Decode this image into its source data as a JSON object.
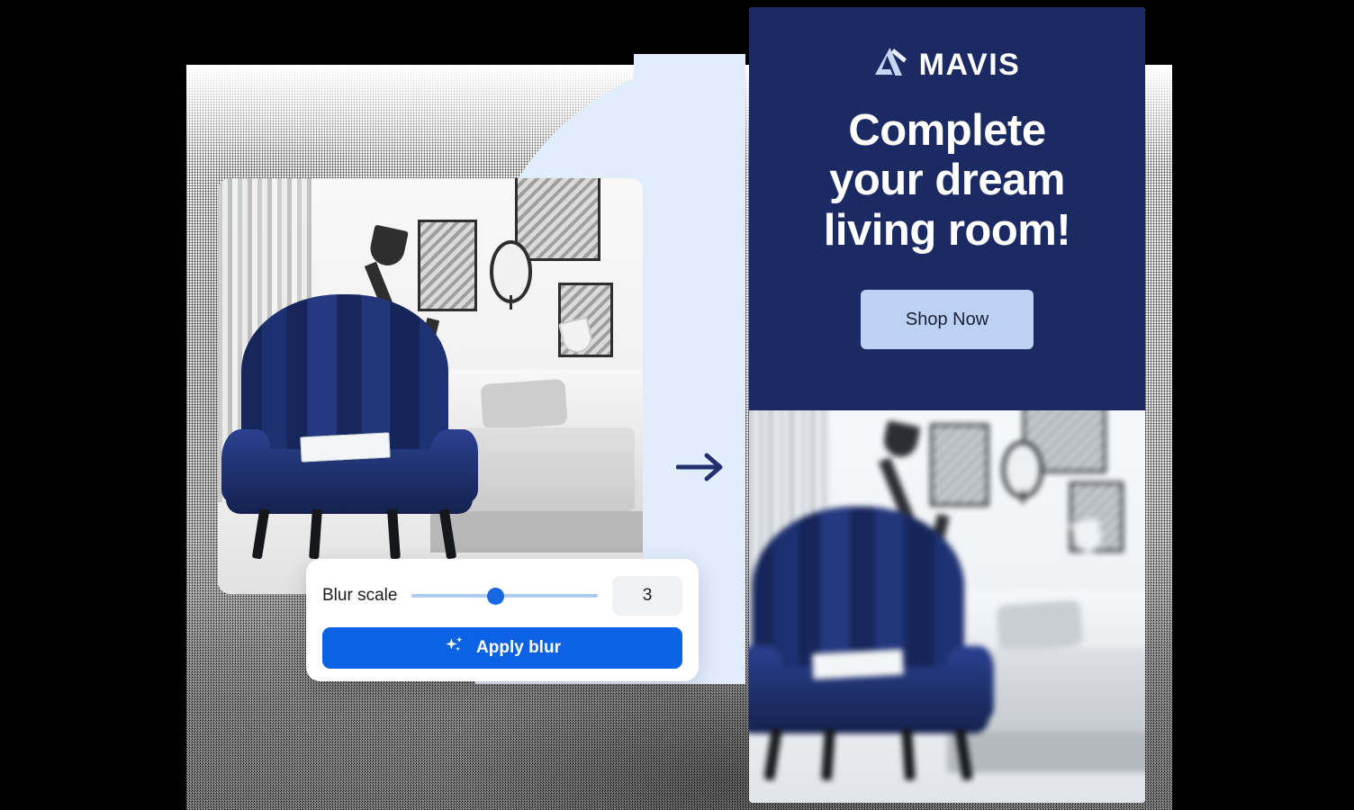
{
  "canvas": {
    "background_color": "#000000",
    "accent_blue": "#0B62E4",
    "panel_blue": "#E2EDFC",
    "brand_navy": "#1B2A63",
    "cta_blue": "#BDD1F4"
  },
  "flow": {
    "arrow_icon": "arrow-right-icon"
  },
  "before_preview": {
    "label": "before-image-preview",
    "alt": "Living room with navy blue armchair"
  },
  "blur_panel": {
    "label": "Blur scale",
    "slider": {
      "value": 3,
      "min": 0,
      "max": 10,
      "percent": 45
    },
    "value_display": "3",
    "apply_button": {
      "label": "Apply blur",
      "icon": "sparkles-icon"
    }
  },
  "ad_creative": {
    "logo": {
      "icon": "mavis-a-mark-icon",
      "wordmark": "MAVIS"
    },
    "headline_lines": [
      "Complete",
      "your dream",
      "living room!"
    ],
    "headline": "Complete your dream living room!",
    "cta": {
      "label": "Shop Now"
    },
    "after_preview": {
      "label": "after-image-preview-blurred",
      "alt": "Blurred living room with navy blue armchair"
    }
  }
}
